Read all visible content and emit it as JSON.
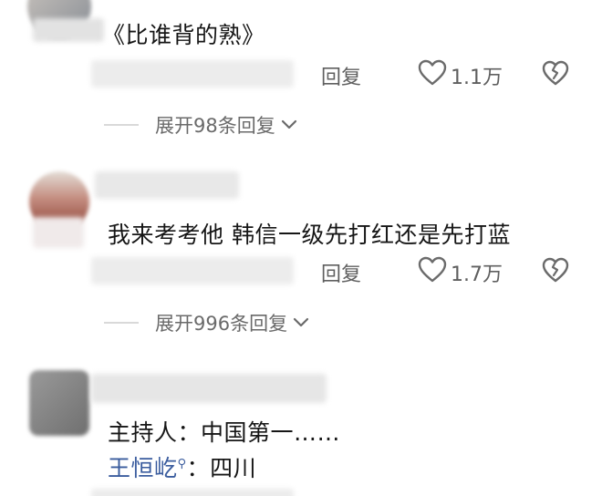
{
  "comments": [
    {
      "text": "《比谁背的熟》",
      "reply_label": "回复",
      "like_count": "1.1万",
      "expand_label": "展开98条回复"
    },
    {
      "text": "我来考考他 韩信一级先打红还是先打蓝",
      "reply_label": "回复",
      "like_count": "1.7万",
      "expand_label": "展开996条回复"
    },
    {
      "text": "主持人：中国第一……",
      "reply_mention": "王恒屹",
      "reply_colon": "：",
      "reply_text": "四川"
    }
  ],
  "colors": {
    "text": "#161616",
    "meta": "#5f5f5f",
    "mention": "#3a5c9e"
  },
  "icons": [
    "heart-outline-icon",
    "broken-heart-icon",
    "chevron-down-icon",
    "search-icon"
  ]
}
